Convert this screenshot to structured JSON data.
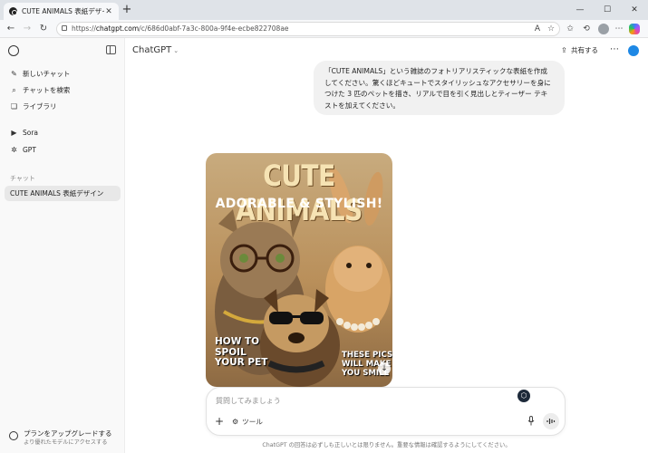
{
  "browser": {
    "tab_title": "CUTE ANIMALS 表紙デザイン",
    "tab_close": "✕",
    "new_tab": "+",
    "url_host": "chatgpt.com",
    "url_prefix": "https://",
    "url_path": "/c/686d0abf-7a3c-800a-9f4e-ecbe822708ae",
    "win_min": "—",
    "win_max": "☐",
    "win_close": "✕"
  },
  "sidebar": {
    "items": [
      {
        "label": "新しいチャット",
        "icon": "✎"
      },
      {
        "label": "チャットを検索",
        "icon": "⌕"
      },
      {
        "label": "ライブラリ",
        "icon": "❏"
      },
      {
        "label": "Sora",
        "icon": "▶"
      },
      {
        "label": "GPT",
        "icon": "✲"
      }
    ],
    "section_label": "チャット",
    "active_chat": "CUTE ANIMALS 表紙デザイン",
    "upgrade_title": "プランをアップグレードする",
    "upgrade_sub": "より優れたモデルにアクセスする"
  },
  "header": {
    "model_name": "ChatGPT",
    "chevron": "⌄",
    "share_label": "共有する",
    "share_icon": "⇪",
    "more": "⋯"
  },
  "user_message": "「CUTE ANIMALS」という雑誌のフォトリアリスティックな表紙を作成してください。驚くほどキュートでスタイリッシュなアクセサリーを身につけた 3 匹のペットを描き、リアルで目を引く見出しとティーザー テキストを加えてください。",
  "cover": {
    "title": "CUTE ANIMALS",
    "subtitle": "ADORABLE & STYLISH!",
    "left_text": "HOW TO\nSPOIL\nYOUR PET",
    "right_text": "THESE PICS\nWILL MAKE\nYOU SMILE"
  },
  "composer": {
    "placeholder": "質問してみましょう",
    "plus": "+",
    "tools_label": "ツール",
    "tools_icon": "⚙",
    "mic": "🎤",
    "voice": "▮▮"
  },
  "disclaimer": "ChatGPT の回答は必ずしも正しいとは限りません。重要な情報は確認するようにしてください。"
}
